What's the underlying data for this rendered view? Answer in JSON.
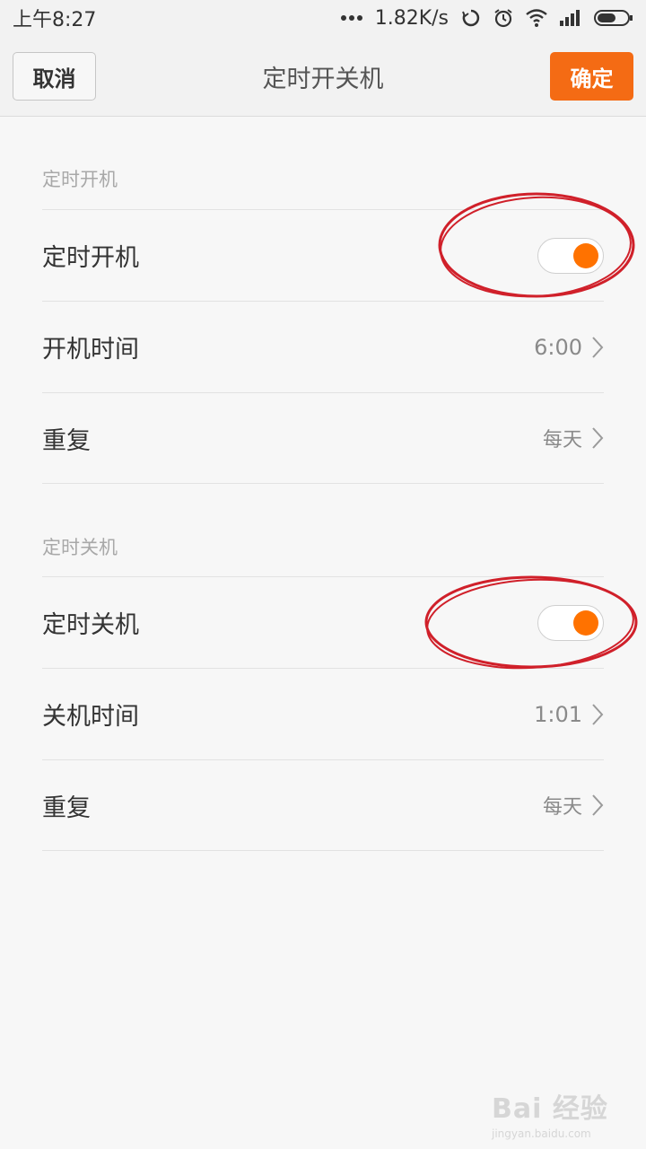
{
  "status_bar": {
    "time": "上午8:27",
    "network_speed": "1.82K/s",
    "icons": [
      "more-dots-icon",
      "sync-icon",
      "alarm-icon",
      "wifi-icon",
      "signal-icon",
      "battery-icon"
    ]
  },
  "title_bar": {
    "cancel_label": "取消",
    "title": "定时开关机",
    "ok_label": "确定"
  },
  "colors": {
    "accent": "#f46b14",
    "toggle_on": "#ff7200",
    "annotation": "#d0202a"
  },
  "power_on_section": {
    "header": "定时开机",
    "toggle_label": "定时开机",
    "toggle_on": true,
    "time_label": "开机时间",
    "time_value": "6:00",
    "repeat_label": "重复",
    "repeat_value": "每天"
  },
  "power_off_section": {
    "header": "定时关机",
    "toggle_label": "定时关机",
    "toggle_on": true,
    "time_label": "关机时间",
    "time_value": "1:01",
    "repeat_label": "重复",
    "repeat_value": "每天"
  },
  "watermark": {
    "main": "Bai 经验",
    "sub": "jingyan.baidu.com"
  }
}
